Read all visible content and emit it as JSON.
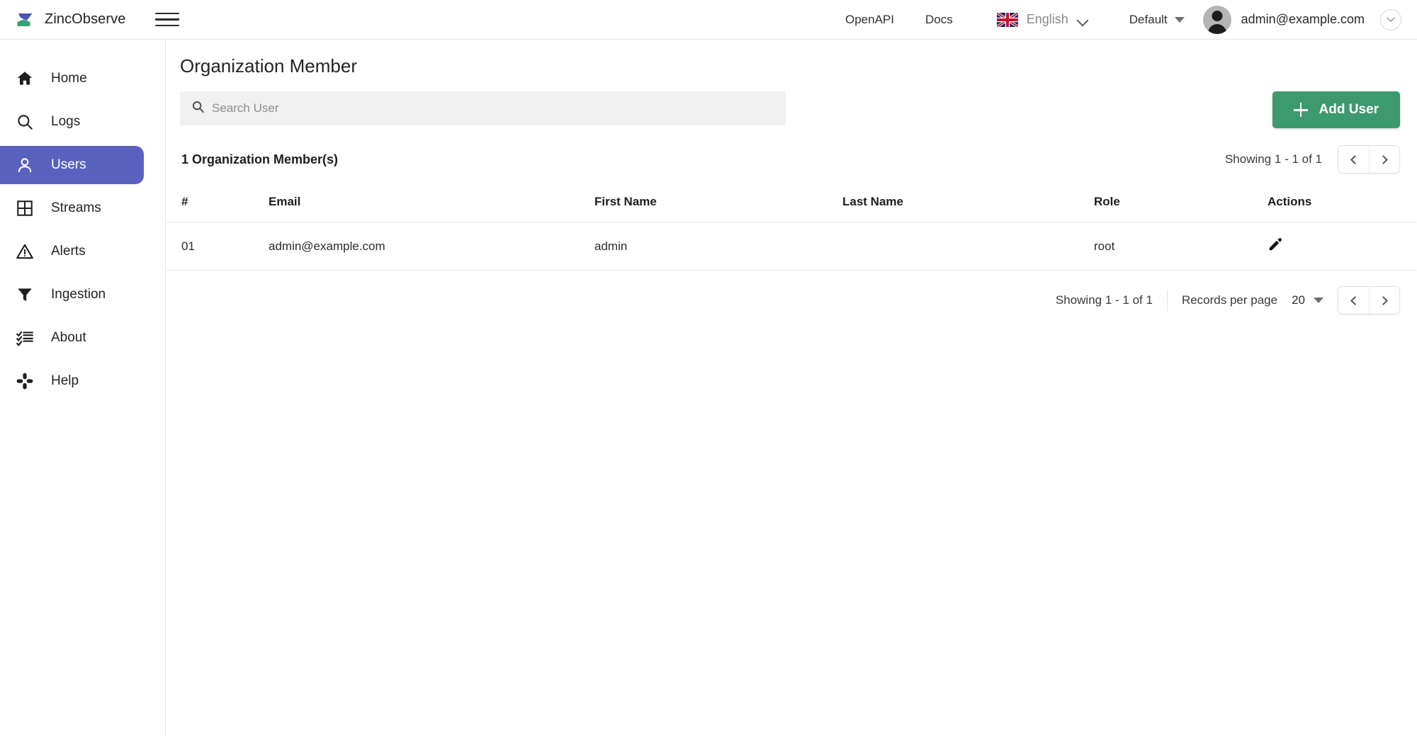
{
  "header": {
    "brand_name": "ZincObserve",
    "logo_icon": "zincobserve-logo",
    "menu_icon": "hamburger-menu-icon",
    "links": [
      {
        "label": "OpenAPI",
        "name": "openapi"
      },
      {
        "label": "Docs",
        "name": "docs"
      }
    ],
    "language": {
      "label": "English",
      "flag_icon": "uk-flag-icon",
      "chevron_icon": "chevron-down-icon"
    },
    "organization": {
      "label": "Default",
      "caret_icon": "caret-down-icon"
    },
    "account": {
      "email": "admin@example.com",
      "avatar_icon": "user-avatar-icon",
      "chevron_icon": "chevron-down-icon"
    }
  },
  "sidebar": {
    "items": [
      {
        "label": "Home",
        "icon": "home-icon",
        "active": false
      },
      {
        "label": "Logs",
        "icon": "search-icon",
        "active": false
      },
      {
        "label": "Users",
        "icon": "user-icon",
        "active": true
      },
      {
        "label": "Streams",
        "icon": "grid-icon",
        "active": false
      },
      {
        "label": "Alerts",
        "icon": "warning-triangle-icon",
        "active": false
      },
      {
        "label": "Ingestion",
        "icon": "funnel-icon",
        "active": false
      },
      {
        "label": "About",
        "icon": "checklist-icon",
        "active": false
      },
      {
        "label": "Help",
        "icon": "help-slack-icon",
        "active": false
      }
    ],
    "active_color": "#5961bf"
  },
  "main": {
    "page_title": "Organization Member",
    "search": {
      "placeholder": "Search User",
      "value": "",
      "icon": "search-icon"
    },
    "add_button": {
      "label": "Add User",
      "icon": "plus-icon",
      "color": "#3c9a6e"
    },
    "count_label": "1 Organization Member(s)",
    "top_pager": {
      "showing": "Showing 1 - 1 of 1",
      "prev_icon": "chevron-left-icon",
      "next_icon": "chevron-right-icon"
    },
    "table": {
      "columns": [
        "#",
        "Email",
        "First Name",
        "Last Name",
        "Role",
        "Actions"
      ],
      "rows": [
        {
          "num": "01",
          "email": "admin@example.com",
          "first_name": "admin",
          "last_name": "",
          "role": "root",
          "action_icon": "edit-pencil-icon"
        }
      ]
    },
    "bottom_pager": {
      "showing": "Showing 1 - 1 of 1",
      "records_per_page_label": "Records per page",
      "records_per_page_value": "20",
      "caret_icon": "caret-down-icon",
      "prev_icon": "chevron-left-icon",
      "next_icon": "chevron-right-icon"
    }
  }
}
